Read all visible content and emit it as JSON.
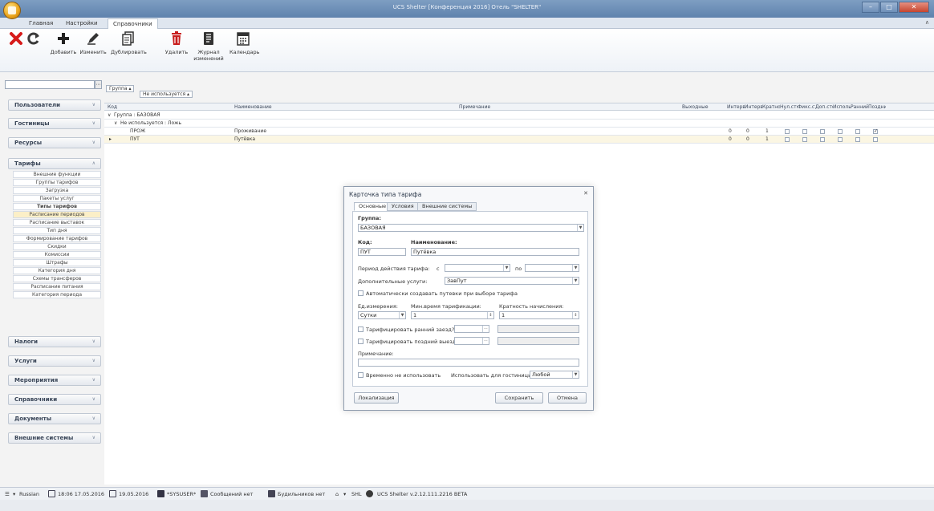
{
  "window": {
    "title": "UCS Shelter [Конференция 2016] Отель \"SHELTER\"",
    "more": "∧"
  },
  "menu": {
    "tabs": [
      "Главная",
      "Настройки",
      "Справочники"
    ]
  },
  "ribbon": {
    "add": "Добавить",
    "edit": "Изменить",
    "duplicate": "Дублировать",
    "delete": "Удалить",
    "journal": "Журнал изменений",
    "calendar": "Календарь"
  },
  "sidebar": {
    "users": "Пользователи",
    "hotels": "Гостиницы",
    "resources": "Ресурсы",
    "tariffs": "Тарифы",
    "tariff_items": [
      "Внешние функции",
      "Группы тарифов",
      "Загрузка",
      "Пакеты услуг",
      "Типы тарифов",
      "Расписание периодов",
      "Расписание выставок",
      "Тип дня",
      "Формирование тарифов",
      "Скидки",
      "Комиссии",
      "Штрафы",
      "Категория дня",
      "Схемы трансферов",
      "Расписание питания",
      "Категория периода"
    ],
    "taxes": "Налоги",
    "services": "Услуги",
    "events": "Мероприятия",
    "references": "Справочники",
    "documents": "Документы",
    "external": "Внешние системы"
  },
  "grid": {
    "group_chip_1": "Группа",
    "group_chip_2": "Не используется",
    "headers": [
      "Код",
      "Наименование",
      "Примечание",
      "Выходные",
      "Интерва",
      "Интерва",
      "Кратнос",
      "Нул.стои",
      "Фикс.ст",
      "Доп.сто",
      "Использ",
      "Ранний з",
      "Поздни"
    ],
    "group_row": "Группа : БАЗОВАЯ",
    "subgroup_row": "Не используется : Ложь",
    "rows": [
      {
        "code": "ПРОЖ",
        "name": "Проживание",
        "v1": "0",
        "v2": "0",
        "v3": "1",
        "late": true
      },
      {
        "code": "ПУТ",
        "name": "Путёвка",
        "v1": "0",
        "v2": "0",
        "v3": "1",
        "late": false
      }
    ]
  },
  "modal": {
    "title": "Карточка типа тарифа",
    "close": "✕",
    "tabs": [
      "Основные",
      "Условия",
      "Внешние системы"
    ],
    "group_label": "Группа:",
    "group_value": "БАЗОВАЯ",
    "code_label": "Код:",
    "code_value": "ПУТ",
    "name_label": "Наименование:",
    "name_value": "Путёвка",
    "period_label": "Период действия тарифа:",
    "from_label": "с",
    "to_label": "по",
    "extra_label": "Дополнительные услуги:",
    "extra_value": "ЗавПут",
    "auto_label": "Автоматически создавать путевки при выборе тарифа",
    "unit_label": "Ед.измерения:",
    "unit_value": "Сутки",
    "min_label": "Мин.время тарификации:",
    "min_value": "1",
    "mult_label": "Кратность начисления:",
    "mult_value": "1",
    "early_label": "Тарифицировать ранний заезд?",
    "late_label": "Тарифицировать поздний выезд?",
    "note_label": "Примечание:",
    "disable_label": "Временно не использовать",
    "hotels_label": "Использовать для гостиницы:",
    "hotels_value": "Любой",
    "localize_btn": "Локализация",
    "save_btn": "Сохранить",
    "cancel_btn": "Отмена"
  },
  "status": {
    "language": "Russian",
    "datetime": "18:06 17.05.2016",
    "date": "19.05.2016",
    "user": "*SYSUSER*",
    "messages": "Сообщений нет",
    "alarms": "Будильников нет",
    "hotel": "SHL",
    "version": "UCS Shelter v.2.12.111.2216 BETA"
  }
}
